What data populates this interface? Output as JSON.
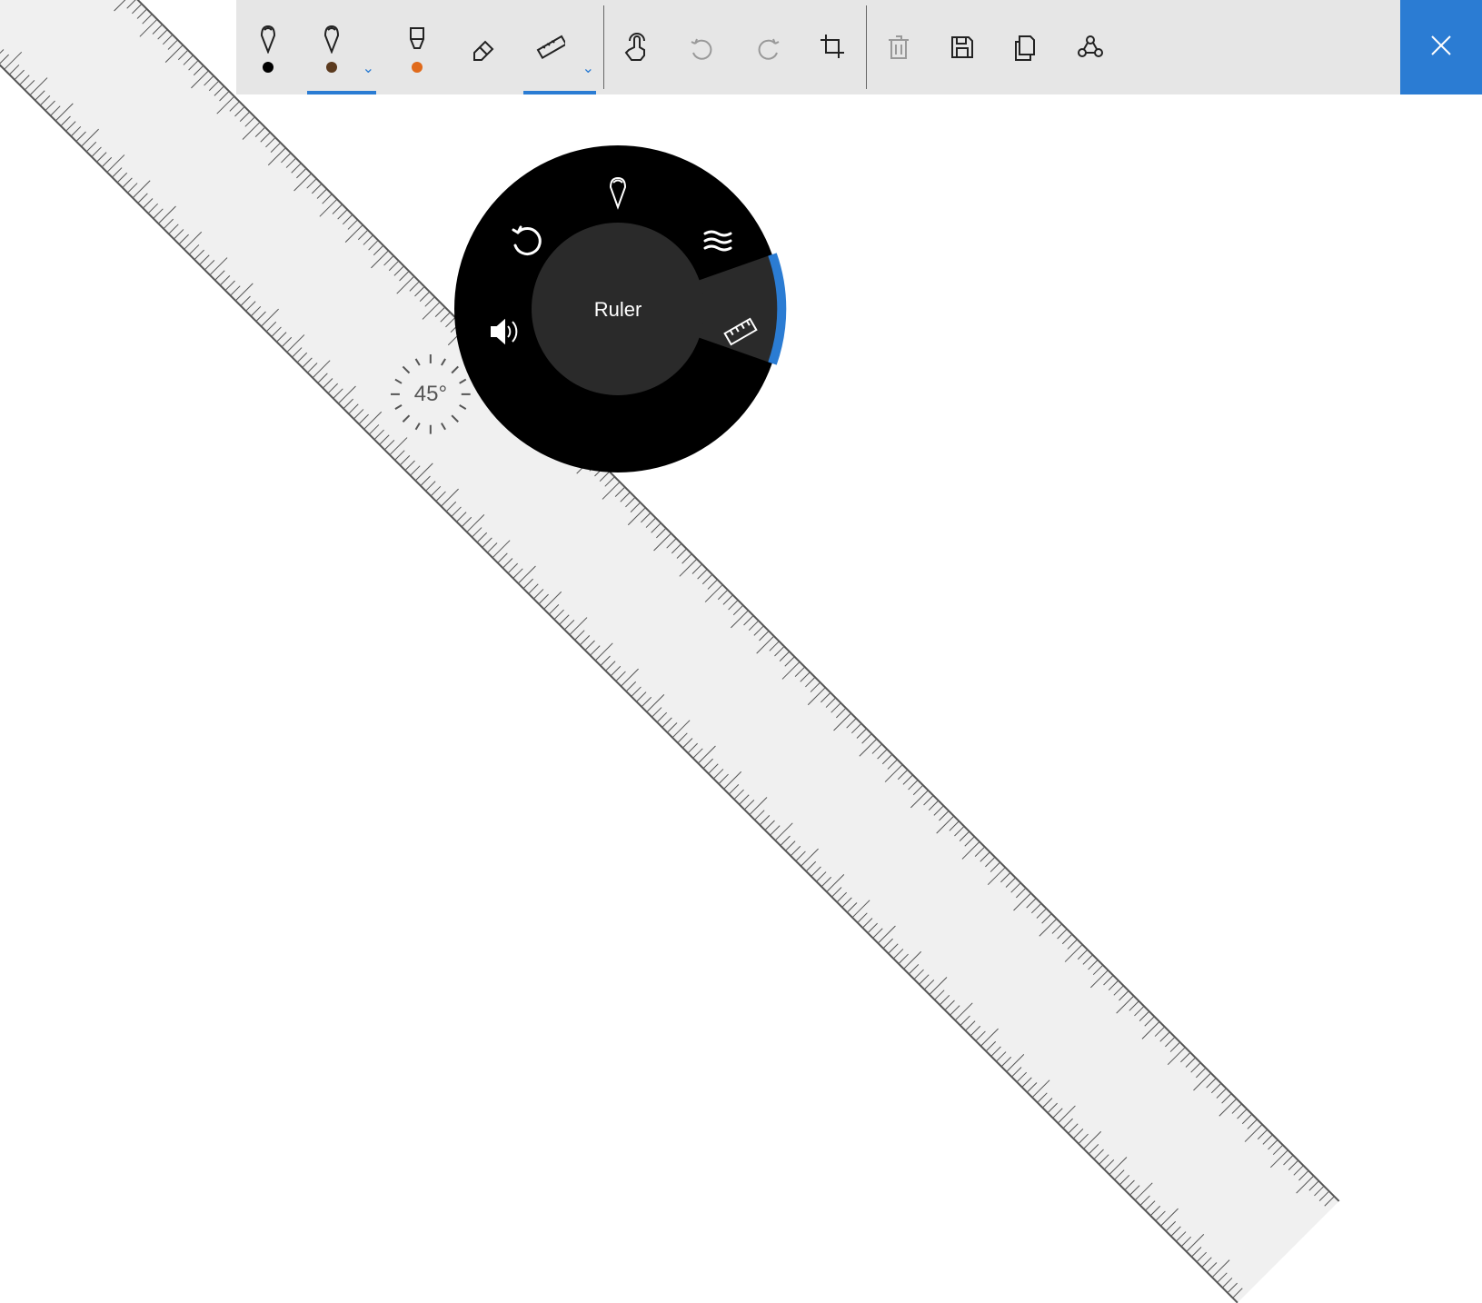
{
  "toolbar": {
    "pens": [
      {
        "name": "ballpoint-pen",
        "swatch": "#000000",
        "active": false,
        "hasDropdown": false
      },
      {
        "name": "pencil",
        "swatch": "#5b3a1e",
        "active": true,
        "hasDropdown": true
      },
      {
        "name": "highlighter",
        "swatch": "#e06a1b",
        "active": false,
        "hasDropdown": false
      }
    ],
    "eraser": {
      "icon": "eraser-icon"
    },
    "ruler": {
      "icon": "ruler-icon",
      "active": true,
      "hasDropdown": true
    },
    "touch": {
      "icon": "touch-icon"
    },
    "undo": {
      "icon": "undo-icon",
      "disabled": true
    },
    "redo": {
      "icon": "redo-icon",
      "disabled": true
    },
    "crop": {
      "icon": "crop-icon"
    },
    "trash": {
      "icon": "trash-icon",
      "disabled": true
    },
    "save": {
      "icon": "save-icon"
    },
    "copy": {
      "icon": "copy-icon"
    },
    "share": {
      "icon": "share-icon"
    },
    "close": {
      "icon": "close-icon"
    }
  },
  "radial": {
    "center_label": "Ruler",
    "selected": "ruler",
    "items": [
      {
        "id": "pen",
        "icon": "pen-icon"
      },
      {
        "id": "stroke",
        "icon": "stroke-width-icon"
      },
      {
        "id": "ruler",
        "icon": "ruler-icon"
      },
      {
        "id": "volume",
        "icon": "volume-icon"
      },
      {
        "id": "undo",
        "icon": "undo-icon"
      }
    ]
  },
  "ruler_tool": {
    "angle_label": "45°",
    "angle_value": 45
  },
  "colors": {
    "accent": "#2b7cd3",
    "toolbar_bg": "#e6e6e6",
    "radial_bg": "#000000",
    "radial_inner": "#2a2a2a",
    "ruler_fill": "#f0f0f0",
    "ruler_stroke": "#555555",
    "icon_muted": "#999999"
  }
}
